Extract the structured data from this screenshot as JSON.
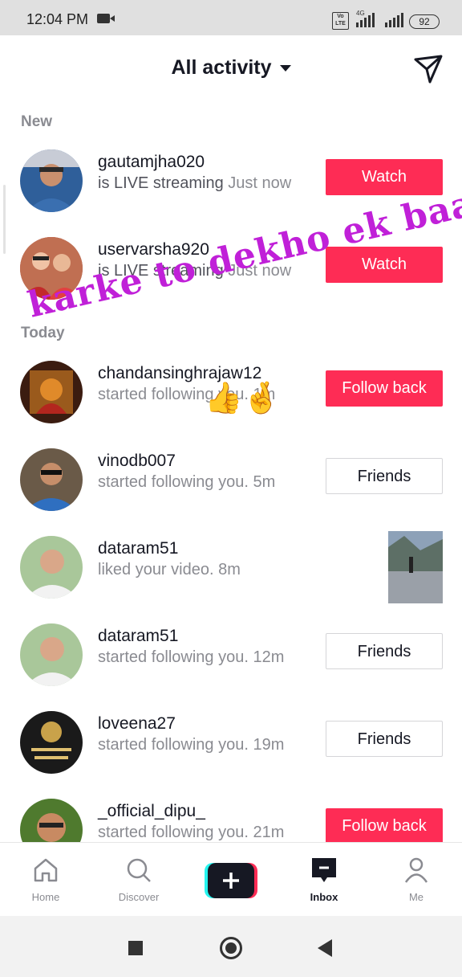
{
  "status_bar": {
    "time": "12:04 PM",
    "network": "4G",
    "volte": "Vo LTE",
    "battery": "92"
  },
  "header": {
    "title": "All activity"
  },
  "sections": {
    "new": "New",
    "today": "Today"
  },
  "rows": [
    {
      "username": "gautamjha020",
      "action": "is LIVE streaming",
      "time": "Just now",
      "button": "Watch"
    },
    {
      "username": "uservarsha920",
      "action": "is LIVE streaming",
      "time": "Just now",
      "button": "Watch"
    },
    {
      "username": "chandansinghrajaw12",
      "action": "started following you.",
      "time": "1m",
      "button": "Follow back"
    },
    {
      "username": "vinodb007",
      "action": "started following you.",
      "time": "5m",
      "button": "Friends"
    },
    {
      "username": "dataram51",
      "action": "liked your video.",
      "time": "8m"
    },
    {
      "username": "dataram51",
      "action": "started following you.",
      "time": "12m",
      "button": "Friends"
    },
    {
      "username": "loveena27",
      "action": "started following you.",
      "time": "19m",
      "button": "Friends"
    },
    {
      "username": "_official_dipu_",
      "action": "started following you.",
      "time": "21m",
      "button": "Follow back"
    }
  ],
  "overlay": {
    "text": "karke to dekho ek baar",
    "emoji": "👍🤞"
  },
  "tabs": [
    {
      "label": "Home",
      "icon": "home-icon"
    },
    {
      "label": "Discover",
      "icon": "search-icon"
    },
    {
      "label": "",
      "icon": "create-icon"
    },
    {
      "label": "Inbox",
      "icon": "inbox-icon"
    },
    {
      "label": "Me",
      "icon": "profile-icon"
    }
  ],
  "colors": {
    "accent": "#fe2c55",
    "text": "#161823",
    "secondary": "#8a8b91",
    "overlay": "#c020d8"
  }
}
